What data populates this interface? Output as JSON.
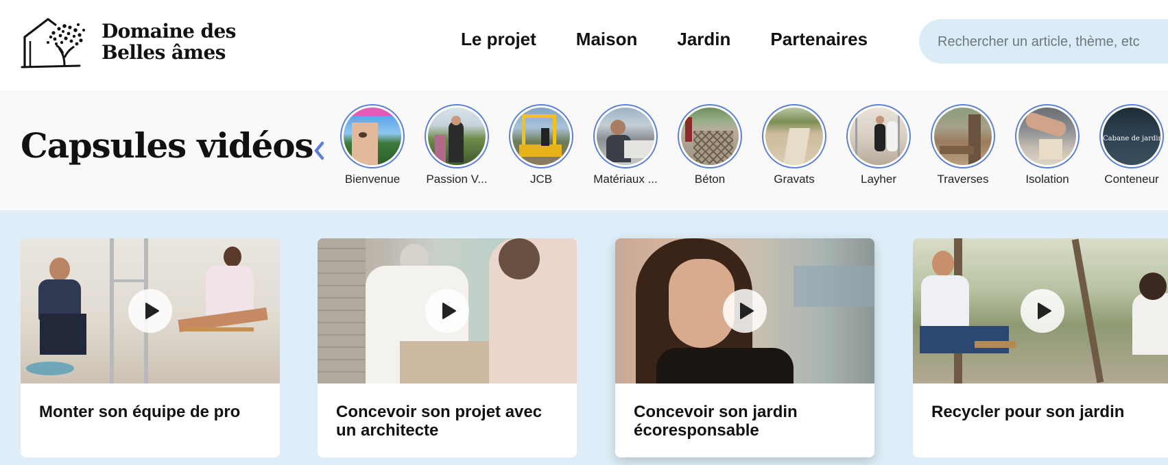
{
  "header": {
    "logo": {
      "line1": "Domaine des",
      "line2": "Belles âmes"
    },
    "nav": [
      "Le projet",
      "Maison",
      "Jardin",
      "Partenaires"
    ],
    "search_placeholder": "Rechercher un article, thème, etc"
  },
  "capsules": {
    "title": "Capsules vidéos",
    "prev_icon": "chevron-left-icon",
    "ring_color": "#5b7fd6",
    "stories": [
      {
        "label": "Bienvenue"
      },
      {
        "label": "Passion V..."
      },
      {
        "label": "JCB"
      },
      {
        "label": "Matériaux ..."
      },
      {
        "label": "Béton"
      },
      {
        "label": "Gravats"
      },
      {
        "label": "Layher"
      },
      {
        "label": "Traverses"
      },
      {
        "label": "Isolation"
      },
      {
        "label": "Conteneur",
        "caption": "Cabane de jardin❤️"
      }
    ]
  },
  "videos": {
    "background": "#deedf7",
    "play_icon": "play-icon",
    "cards": [
      {
        "title": "Monter son équipe de pro"
      },
      {
        "title": "Concevoir son projet avec un architecte"
      },
      {
        "title": "Concevoir son jardin écoresponsable"
      },
      {
        "title": "Recycler pour son jardin"
      }
    ]
  }
}
